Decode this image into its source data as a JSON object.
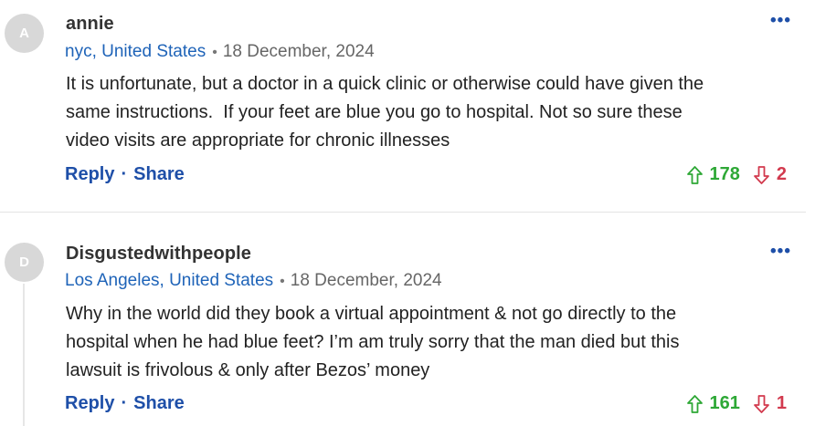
{
  "comments": [
    {
      "avatar_letter": "A",
      "username": "annie",
      "location": "nyc, United States",
      "separator": "•",
      "date": "18 December, 2024",
      "more_label": "•••",
      "body": "It is unfortunate, but a doctor in a quick clinic or otherwise could have given the\nsame instructions.  If your feet are blue you go to hospital. Not so sure these\nvideo visits are appropriate for chronic illnesses",
      "reply_label": "Reply",
      "share_label": "Share",
      "action_sep": "·",
      "upvotes": "178",
      "downvotes": "2"
    },
    {
      "avatar_letter": "D",
      "username": "Disgustedwithpeople",
      "location": "Los Angeles, United States",
      "separator": "•",
      "date": "18 December, 2024",
      "more_label": "•••",
      "body": "Why in the world did they book a virtual appointment & not go directly to the\nhospital when he had blue feet? I’m am truly sorry that the man died but this\nlawsuit is frivolous & only after Bezos’ money",
      "reply_label": "Reply",
      "share_label": "Share",
      "action_sep": "·",
      "upvotes": "161",
      "downvotes": "1"
    }
  ],
  "colors": {
    "link": "#1e63b8",
    "action": "#1e4fa8",
    "upvote": "#2ea836",
    "downvote": "#d23a4e",
    "avatar_bg": "#d8d8d8"
  },
  "icons": {
    "upvote": "arrow-up-outline-icon",
    "downvote": "arrow-down-outline-icon",
    "more": "ellipsis-icon"
  }
}
